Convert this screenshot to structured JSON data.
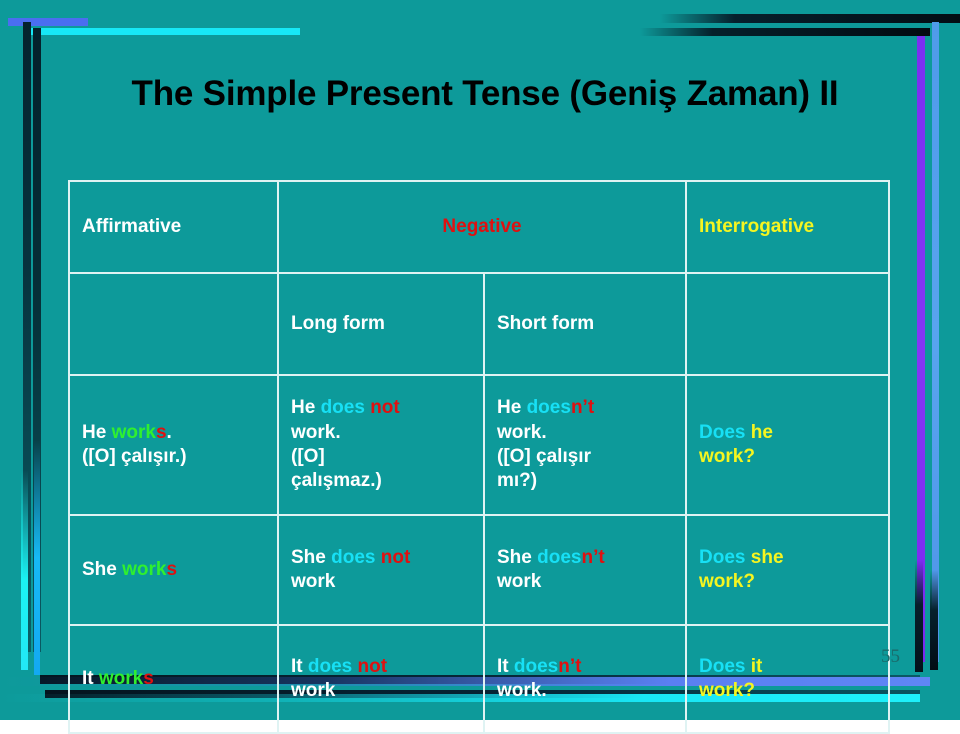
{
  "slide": {
    "title": "The Simple Present Tense (Geniş Zaman) II",
    "number": "55",
    "background_color": "#0d9a9a"
  },
  "colors": {
    "white": "#ffffff",
    "green": "#2ff02f",
    "red": "#e01010",
    "cyan": "#17e0f5",
    "yellow": "#f5f520",
    "title": "#000000",
    "border": "#dff3f3"
  },
  "table": {
    "header": {
      "affirmative": "Affirmative",
      "negative": "Negative",
      "interrogative": "Interrogative"
    },
    "subheader": {
      "long_form": "Long form",
      "short_form": "Short form"
    },
    "rows": [
      {
        "id": "he",
        "affirmative": {
          "line1": {
            "subject": "He ",
            "verb_stem": "work",
            "verb_s": "s",
            "tail": "."
          },
          "line2": "([O] çalışır.)"
        },
        "long_form": {
          "line1": {
            "subject": "He ",
            "aux": "does ",
            "neg": "not"
          },
          "line2": "work.",
          "line3": "([O]",
          "line4": "çalışmaz.)"
        },
        "short_form": {
          "line1": {
            "subject": "He ",
            "aux": "does",
            "neg": "n’t"
          },
          "line2": "work.",
          "line3": "([O] çalışır",
          "line4": "mı?)"
        },
        "interrogative": {
          "aux": "Does ",
          "subject": "he",
          "verb": "work?"
        }
      },
      {
        "id": "she",
        "affirmative": {
          "line1": {
            "subject": "She ",
            "verb_stem": "work",
            "verb_s": "s",
            "tail": ""
          },
          "line2": ""
        },
        "long_form": {
          "line1": {
            "subject": "She ",
            "aux": "does ",
            "neg": "not"
          },
          "line2": "work",
          "line3": "",
          "line4": ""
        },
        "short_form": {
          "line1": {
            "subject": "She ",
            "aux": "does",
            "neg": "n’t"
          },
          "line2": "work",
          "line3": "",
          "line4": ""
        },
        "interrogative": {
          "aux": "Does ",
          "subject": "she",
          "verb": "work?"
        }
      },
      {
        "id": "it",
        "affirmative": {
          "line1": {
            "subject": "It  ",
            "verb_stem": "work",
            "verb_s": "s",
            "tail": ""
          },
          "line2": ""
        },
        "long_form": {
          "line1": {
            "subject": "It  ",
            "aux": "does ",
            "neg": "not"
          },
          "line2": "work",
          "line3": "",
          "line4": ""
        },
        "short_form": {
          "line1": {
            "subject": "It ",
            "aux": "does",
            "neg": "n’t"
          },
          "line2": "work.",
          "line3": "",
          "line4": ""
        },
        "interrogative": {
          "aux": "Does ",
          "subject": "it",
          "verb": "work?"
        }
      }
    ]
  }
}
